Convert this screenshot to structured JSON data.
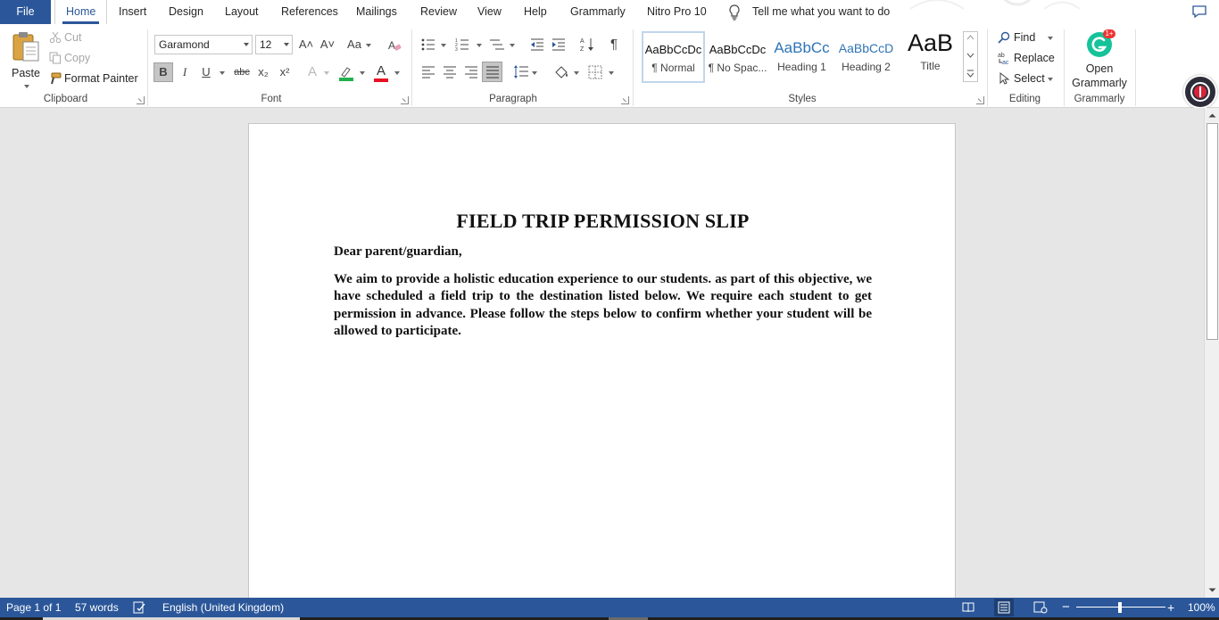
{
  "tabs": {
    "file": "File",
    "home": "Home",
    "insert": "Insert",
    "design": "Design",
    "layout": "Layout",
    "references": "References",
    "mailings": "Mailings",
    "review": "Review",
    "view": "View",
    "help": "Help",
    "grammarly": "Grammarly",
    "nitro": "Nitro Pro 10",
    "tell_me": "Tell me what you want to do"
  },
  "clipboard": {
    "label": "Clipboard",
    "paste": "Paste",
    "cut": "Cut",
    "copy": "Copy",
    "format_painter": "Format Painter"
  },
  "font": {
    "label": "Font",
    "font_name": "Garamond",
    "font_size": "12",
    "bold": "B",
    "italic": "I",
    "underline": "U",
    "strikethrough": "abc",
    "subscript": "x₂",
    "superscript": "x²",
    "case": "Aa",
    "grow": "A˄",
    "shrink": "A˅",
    "effects": "A",
    "font_color": "A",
    "highlight_color": "#22b14c",
    "font_color_value": "#e81123"
  },
  "paragraph": {
    "label": "Paragraph",
    "pilcrow": "¶"
  },
  "styles": {
    "label": "Styles",
    "items": [
      {
        "sample": "AaBbCcDc",
        "name": "¶ Normal"
      },
      {
        "sample": "AaBbCcDc",
        "name": "¶ No Spac..."
      },
      {
        "sample": "AaBbCc",
        "name": "Heading 1"
      },
      {
        "sample": "AaBbCcD",
        "name": "Heading 2"
      },
      {
        "sample": "AaB",
        "name": "Title"
      }
    ]
  },
  "editing": {
    "label": "Editing",
    "find": "Find",
    "replace": "Replace",
    "select": "Select"
  },
  "grammarly_group": {
    "label": "Grammarly",
    "open_line1": "Open",
    "open_line2": "Grammarly",
    "badge": "1+"
  },
  "document": {
    "title": "FIELD TRIP PERMISSION SLIP",
    "salutation": "Dear parent/guardian,",
    "body": "We aim to provide a holistic education experience to our students. as part of this objective, we have scheduled a field trip to the destination listed below. We require each student to get permission in advance. Please follow the steps below to confirm whether your student will be allowed to participate."
  },
  "status": {
    "page": "Page 1 of 1",
    "words": "57 words",
    "language": "English (United Kingdom)",
    "zoom": "100%"
  },
  "colors": {
    "accent": "#2b579a",
    "grammarly": "#15c39a"
  }
}
